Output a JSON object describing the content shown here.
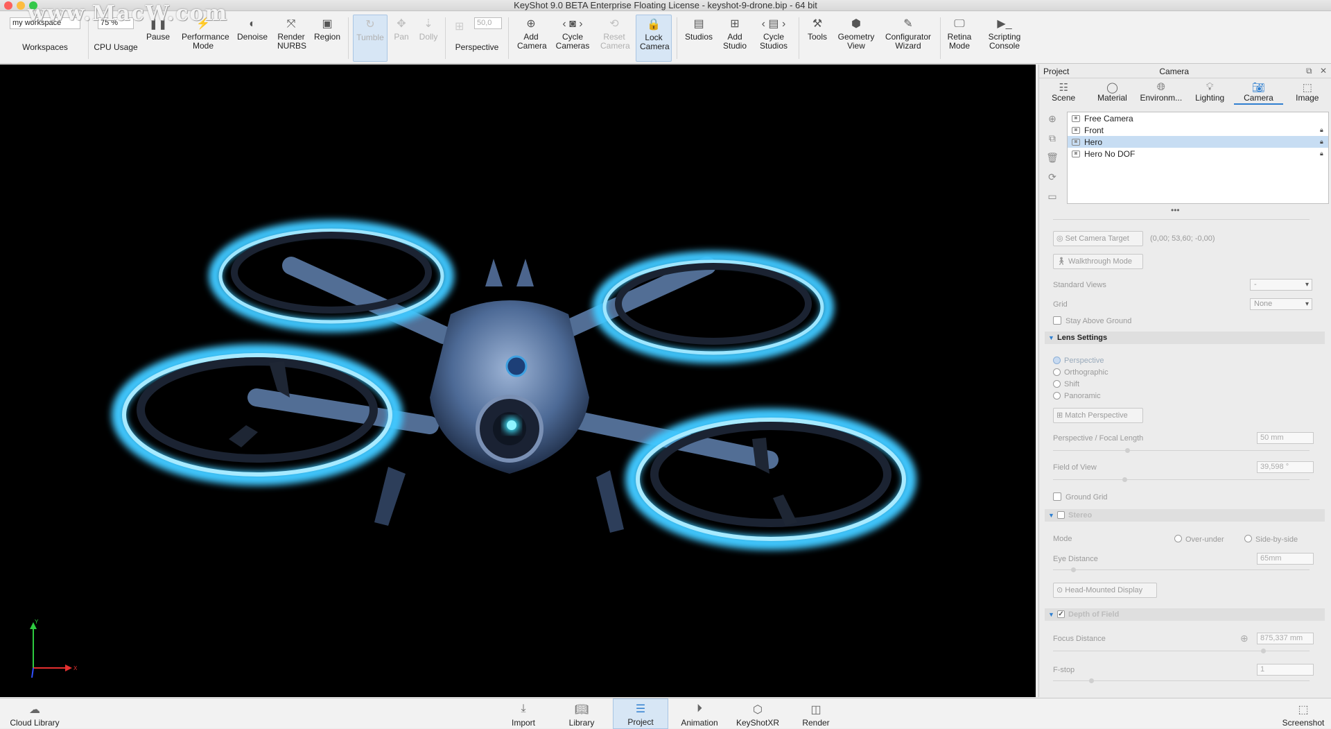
{
  "window": {
    "title": "KeyShot 9.0 BETA Enterprise Floating License  - keyshot-9-drone.bip  - 64 bit",
    "watermark": "www.MacW.com"
  },
  "toolbar": {
    "workspace_value": "my workspace",
    "cpu_value": "75 %",
    "perspective_value": "50,0",
    "buttons": {
      "workspaces": "Workspaces",
      "cpu_usage": "CPU Usage",
      "pause": "Pause",
      "performance_mode": "Performance Mode",
      "denoise": "Denoise",
      "render_nurbs": "Render NURBS",
      "region": "Region",
      "tumble": "Tumble",
      "pan": "Pan",
      "dolly": "Dolly",
      "perspective": "Perspective",
      "add_camera": "Add Camera",
      "cycle_cameras": "Cycle Cameras",
      "reset_camera": "Reset Camera",
      "lock_camera": "Lock Camera",
      "studios": "Studios",
      "add_studio": "Add Studio",
      "cycle_studios": "Cycle Studios",
      "tools": "Tools",
      "geometry_view": "Geometry View",
      "configurator_wizard": "Configurator Wizard",
      "retina_mode": "Retina Mode",
      "scripting_console": "Scripting Console"
    }
  },
  "viewport": {
    "axis_y": "Y",
    "axis_x": "X"
  },
  "panel": {
    "left_title": "Project",
    "center_title": "Camera",
    "tabs": [
      "Scene",
      "Material",
      "Environm...",
      "Lighting",
      "Camera",
      "Image"
    ],
    "selected_tab": "Camera",
    "cameras": [
      {
        "name": "Free Camera",
        "locked": false,
        "selected": false
      },
      {
        "name": "Front",
        "locked": true,
        "selected": false
      },
      {
        "name": "Hero",
        "locked": true,
        "selected": true
      },
      {
        "name": "Hero No DOF",
        "locked": true,
        "selected": false
      }
    ],
    "set_camera_target": "Set Camera Target",
    "camera_target_coords": "(0,00; 53,60; -0,00)",
    "walkthrough_mode": "Walkthrough Mode",
    "standard_views_label": "Standard Views",
    "standard_views_value": "-",
    "grid_label": "Grid",
    "grid_value": "None",
    "stay_above_ground": "Stay Above Ground",
    "lens_settings": "Lens Settings",
    "lens_options": [
      "Perspective",
      "Orthographic",
      "Shift",
      "Panoramic"
    ],
    "lens_selected": "Perspective",
    "match_perspective": "Match Perspective",
    "focal_length_label": "Perspective / Focal Length",
    "focal_length_value": "50 mm",
    "focal_length_pos": 0.28,
    "fov_label": "Field of View",
    "fov_value": "39,598 °",
    "fov_pos": 0.27,
    "ground_grid": "Ground Grid",
    "stereo": "Stereo",
    "mode_label": "Mode",
    "mode_options": [
      "Over-under",
      "Side-by-side"
    ],
    "eye_distance_label": "Eye Distance",
    "eye_distance_value": "65mm",
    "eye_distance_pos": 0.07,
    "head_mounted_display": "Head-Mounted Display",
    "depth_of_field": "Depth of Field",
    "focus_distance_label": "Focus Distance",
    "focus_distance_value": "875,337 mm",
    "focus_distance_pos": 0.81,
    "fstop_label": "F-stop",
    "fstop_value": "1",
    "fstop_pos": 0.14
  },
  "bottombar": {
    "cloud_library": "Cloud Library",
    "import": "Import",
    "library": "Library",
    "project": "Project",
    "animation": "Animation",
    "keyshotxr": "KeyShotXR",
    "render": "Render",
    "screenshot": "Screenshot"
  },
  "colors": {
    "accent": "#2f7fd0",
    "glow": "#3fc8ff",
    "selected_row": "#c7ddf3"
  }
}
